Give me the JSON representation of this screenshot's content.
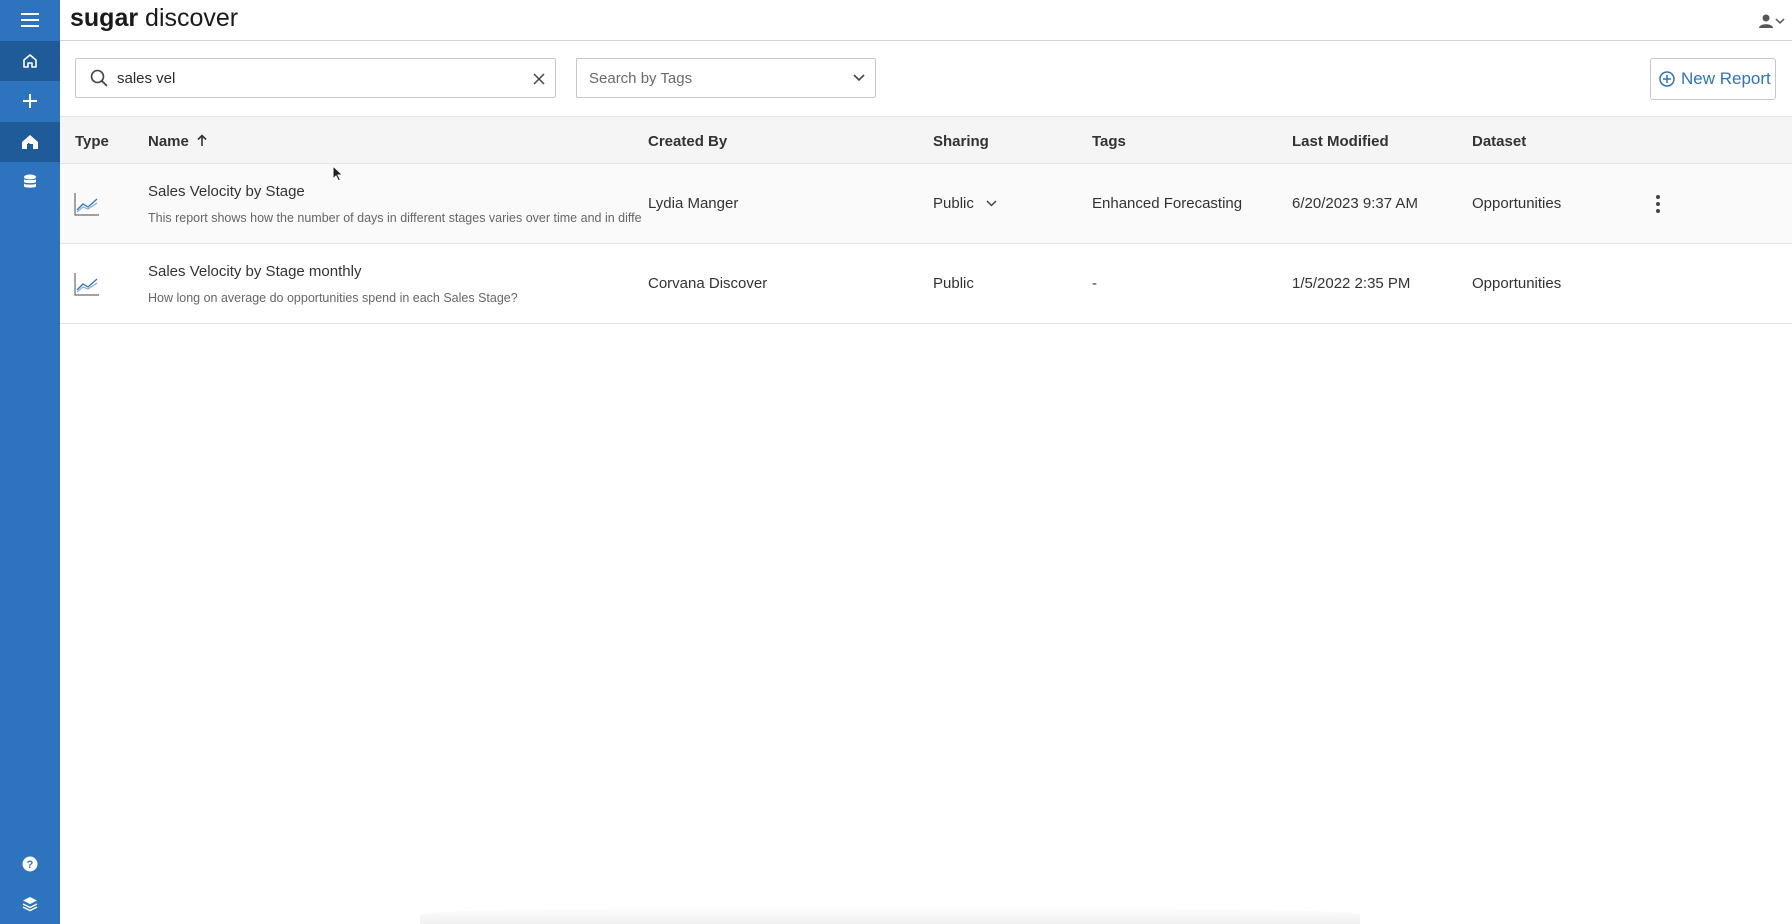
{
  "app": {
    "brand_bold": "sugar",
    "brand_light": " discover"
  },
  "sidebar": {
    "items": [
      {
        "icon": "menu-icon"
      },
      {
        "icon": "home-icon"
      },
      {
        "icon": "plus-icon"
      },
      {
        "icon": "reports-home-icon"
      },
      {
        "icon": "database-icon"
      },
      {
        "icon": "help-icon"
      },
      {
        "icon": "layers-icon"
      }
    ]
  },
  "toolbar": {
    "search_value": "sales vel",
    "tags_placeholder": "Search by Tags",
    "new_report_label": "New Report"
  },
  "table": {
    "columns": {
      "type": "Type",
      "name": "Name",
      "created_by": "Created By",
      "sharing": "Sharing",
      "tags": "Tags",
      "last_modified": "Last Modified",
      "dataset": "Dataset"
    },
    "rows": [
      {
        "name": "Sales Velocity by Stage",
        "description": "This report shows how the number of days in different stages varies over time and in differe",
        "created_by": "Lydia Manger",
        "sharing": "Public",
        "tags": "Enhanced Forecasting",
        "last_modified": "6/20/2023 9:37 AM",
        "dataset": "Opportunities"
      },
      {
        "name": "Sales Velocity by Stage monthly",
        "description": "How long on average do opportunities spend in each Sales Stage?",
        "created_by": "Corvana Discover",
        "sharing": "Public",
        "tags": "-",
        "last_modified": "1/5/2022 2:35 PM",
        "dataset": "Opportunities"
      }
    ]
  },
  "colors": {
    "sidebar": "#2e73bd",
    "sidebar_active": "#1f5a99",
    "accent": "#2e73bd"
  }
}
